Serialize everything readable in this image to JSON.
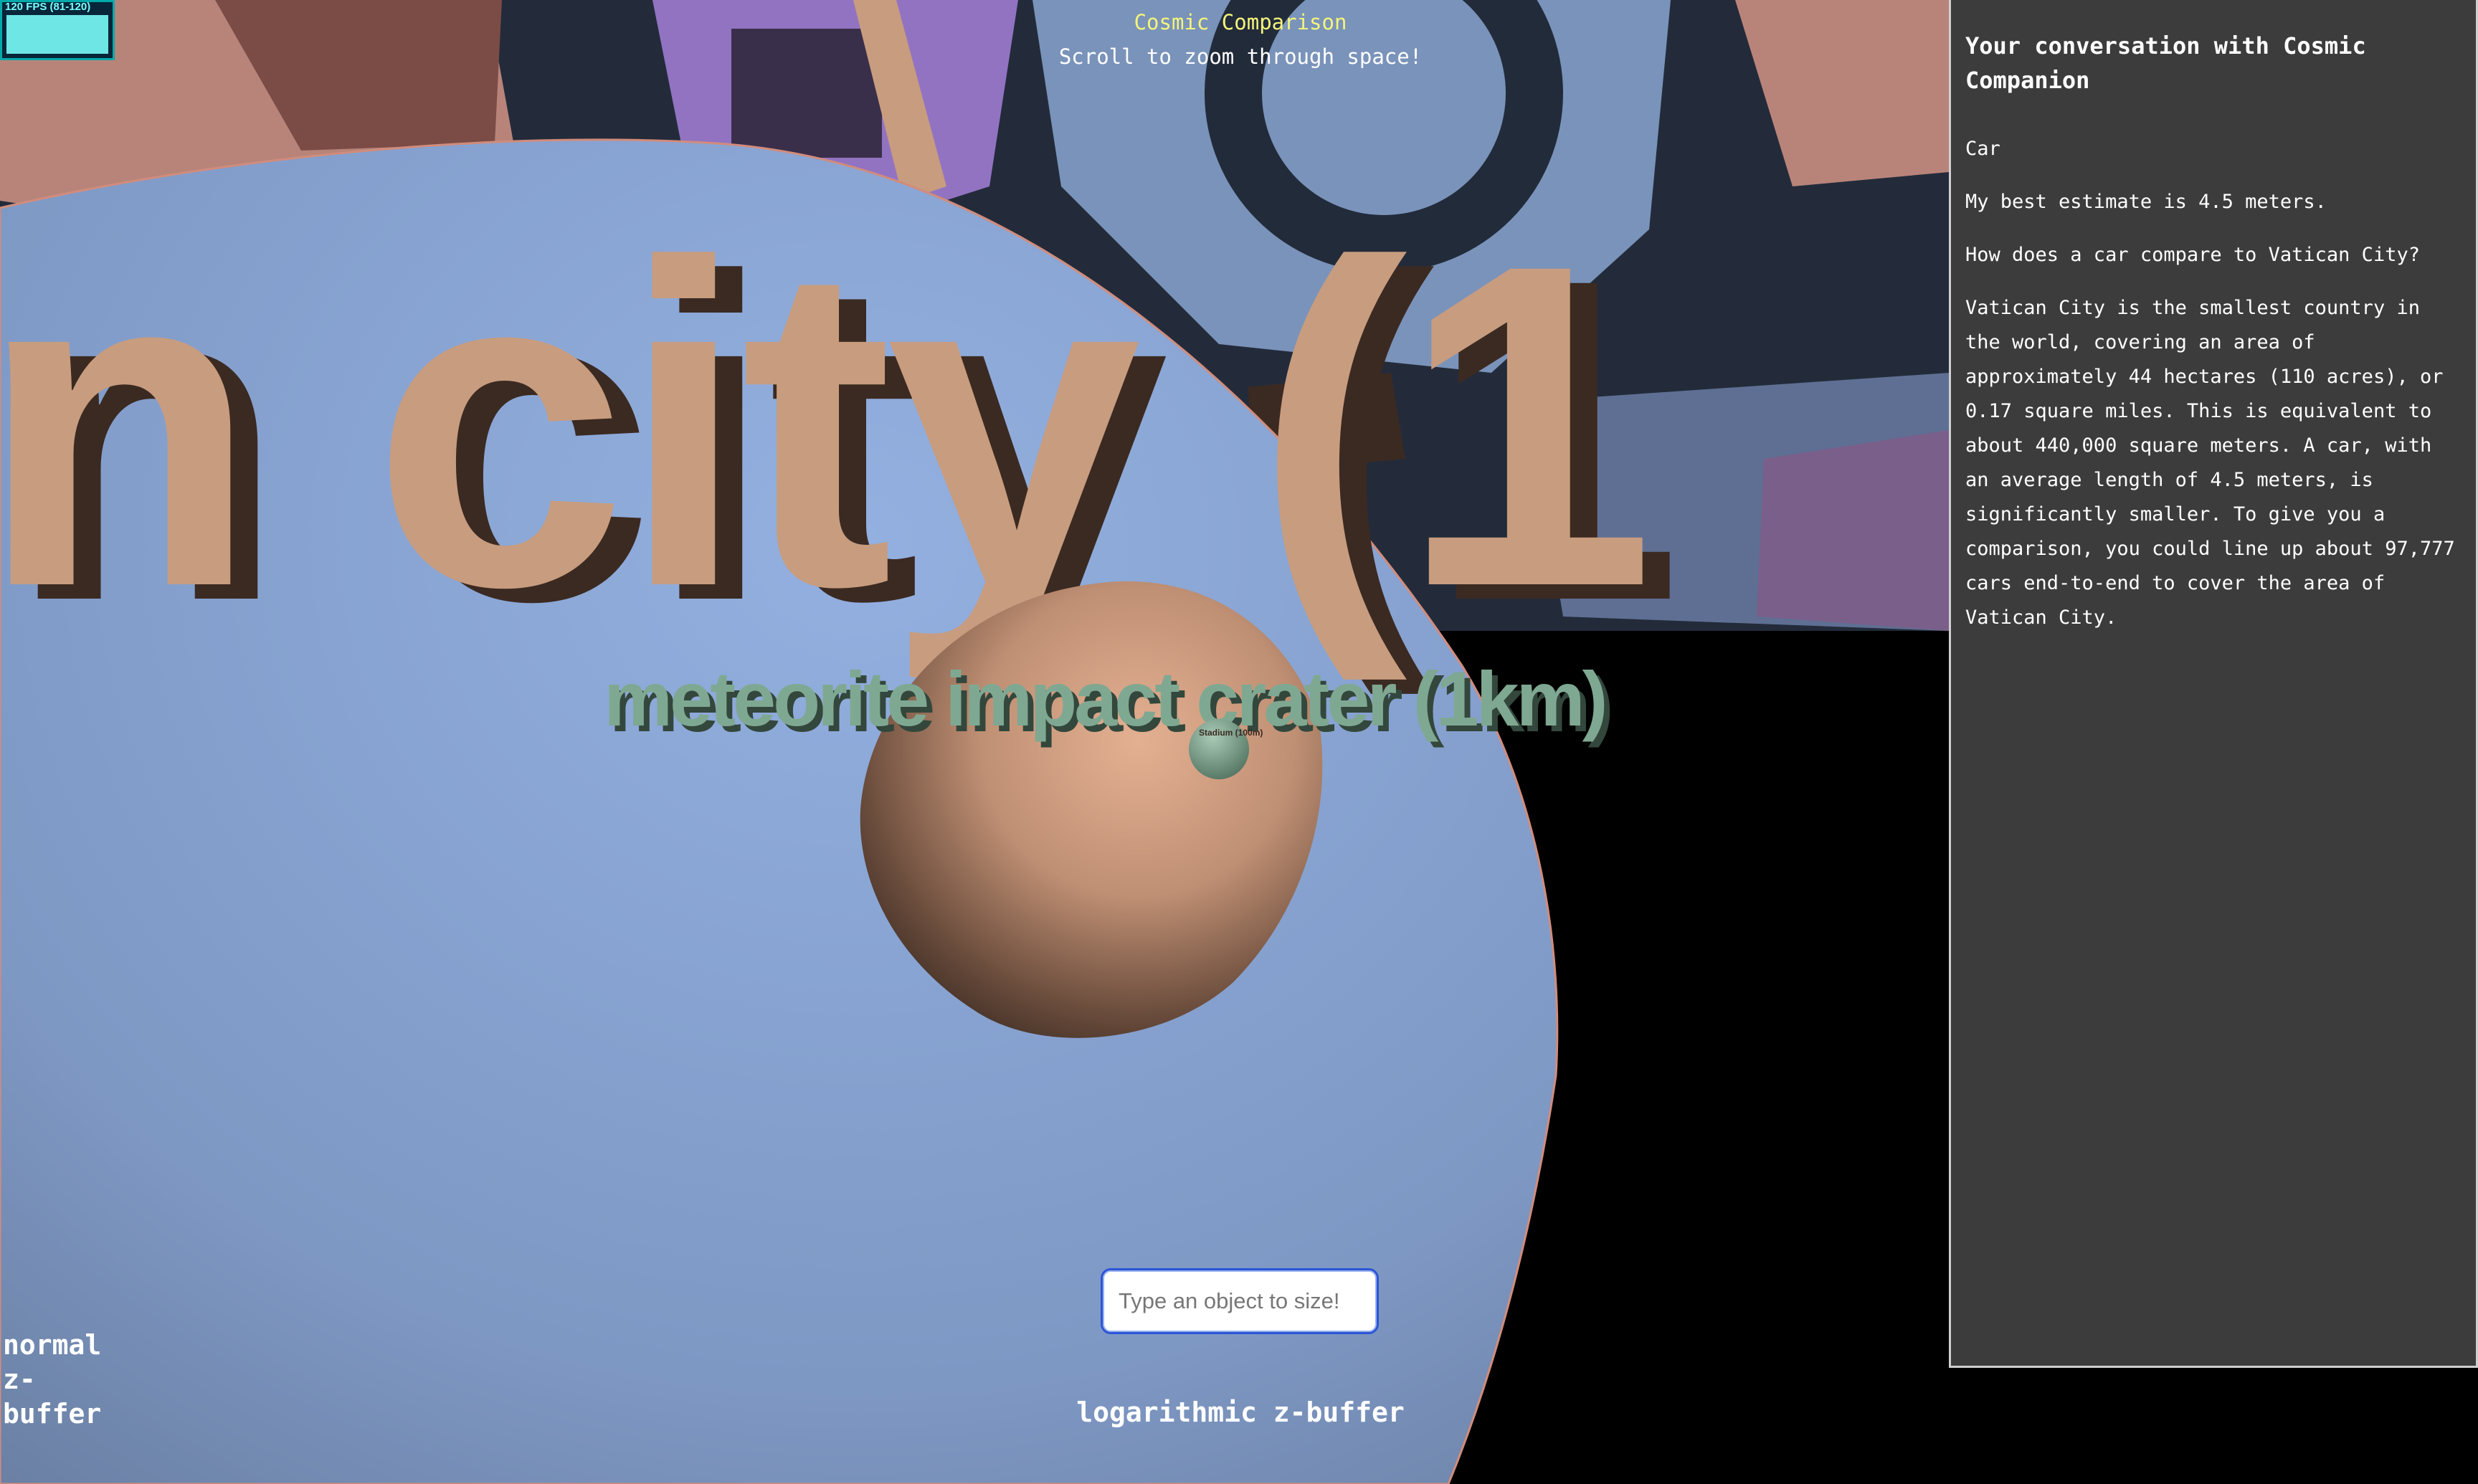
{
  "fps": {
    "label": "120 FPS (81-120)"
  },
  "header": {
    "title": "Cosmic Comparison",
    "subtitle": "Scroll to zoom through space!"
  },
  "scene": {
    "big_label_fragment": "n city (1",
    "crater_label": "meteorite impact crater (1km)",
    "tiny_label": "Stadium (100m)",
    "colors": {
      "background": "#000000",
      "big_blob": "#8aa6d6",
      "tan": "#c89c7e",
      "tan_shadow": "#3b2a22",
      "green": "#7fa892",
      "purple": "#8f6fbf",
      "dark_navy": "#222b3a"
    }
  },
  "search": {
    "placeholder": "Type an object to size!",
    "value": ""
  },
  "zbuffer": {
    "normal_label": "normal z-buffer",
    "log_label": "logarithmic z-buffer"
  },
  "chat": {
    "title": "Your conversation with Cosmic Companion",
    "messages": [
      {
        "text": "Car"
      },
      {
        "text": "My best estimate is 4.5 meters."
      },
      {
        "text": "How does a car compare to Vatican City?"
      },
      {
        "text": "Vatican City is the smallest country in the world, covering an area of approximately 44 hectares (110 acres), or 0.17 square miles. This is equivalent to about 440,000 square meters. A car, with an average length of 4.5 meters, is significantly smaller. To give you a comparison, you could line up about 97,777 cars end-to-end to cover the area of Vatican City."
      }
    ]
  }
}
